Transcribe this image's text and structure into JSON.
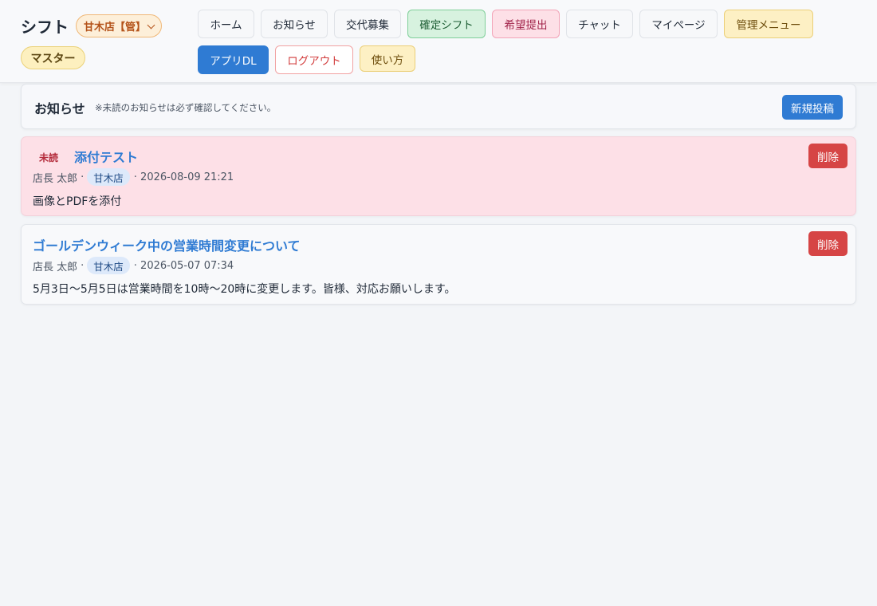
{
  "header": {
    "title": "シフト",
    "store_select": "甘木店【管】",
    "role": "マスター",
    "nav": [
      {
        "label": "ホーム"
      },
      {
        "label": "お知らせ"
      },
      {
        "label": "交代募集"
      },
      {
        "label": "確定シフト"
      },
      {
        "label": "希望提出"
      },
      {
        "label": "チャット"
      },
      {
        "label": "マイページ"
      },
      {
        "label": "管理メニュー"
      },
      {
        "label": "アプリDL"
      },
      {
        "label": "ログアウト"
      },
      {
        "label": "使い方"
      }
    ]
  },
  "section": {
    "title": "お知らせ",
    "note": "※未読のお知らせは必ず確認してください。",
    "new_post": "新規投稿"
  },
  "notices": [
    {
      "unread_label": "未読",
      "title": "添付テスト",
      "author": "店長 太郎",
      "sep": "·",
      "store": "甘木店",
      "datetime": "· 2026-08-09 21:21",
      "body": "画像とPDFを添付",
      "delete": "削除"
    },
    {
      "title": "ゴールデンウィーク中の営業時間変更について",
      "author": "店長 太郎",
      "sep": "·",
      "store": "甘木店",
      "datetime": "· 2026-05-07 07:34",
      "body": "5月3日〜5月5日は営業時間を10時〜20時に変更します。皆様、対応お願いします。",
      "delete": "削除"
    }
  ],
  "colors": {
    "accent": "#2f7bd3",
    "danger": "#d64545",
    "unread_bg": "#fde0e7"
  }
}
